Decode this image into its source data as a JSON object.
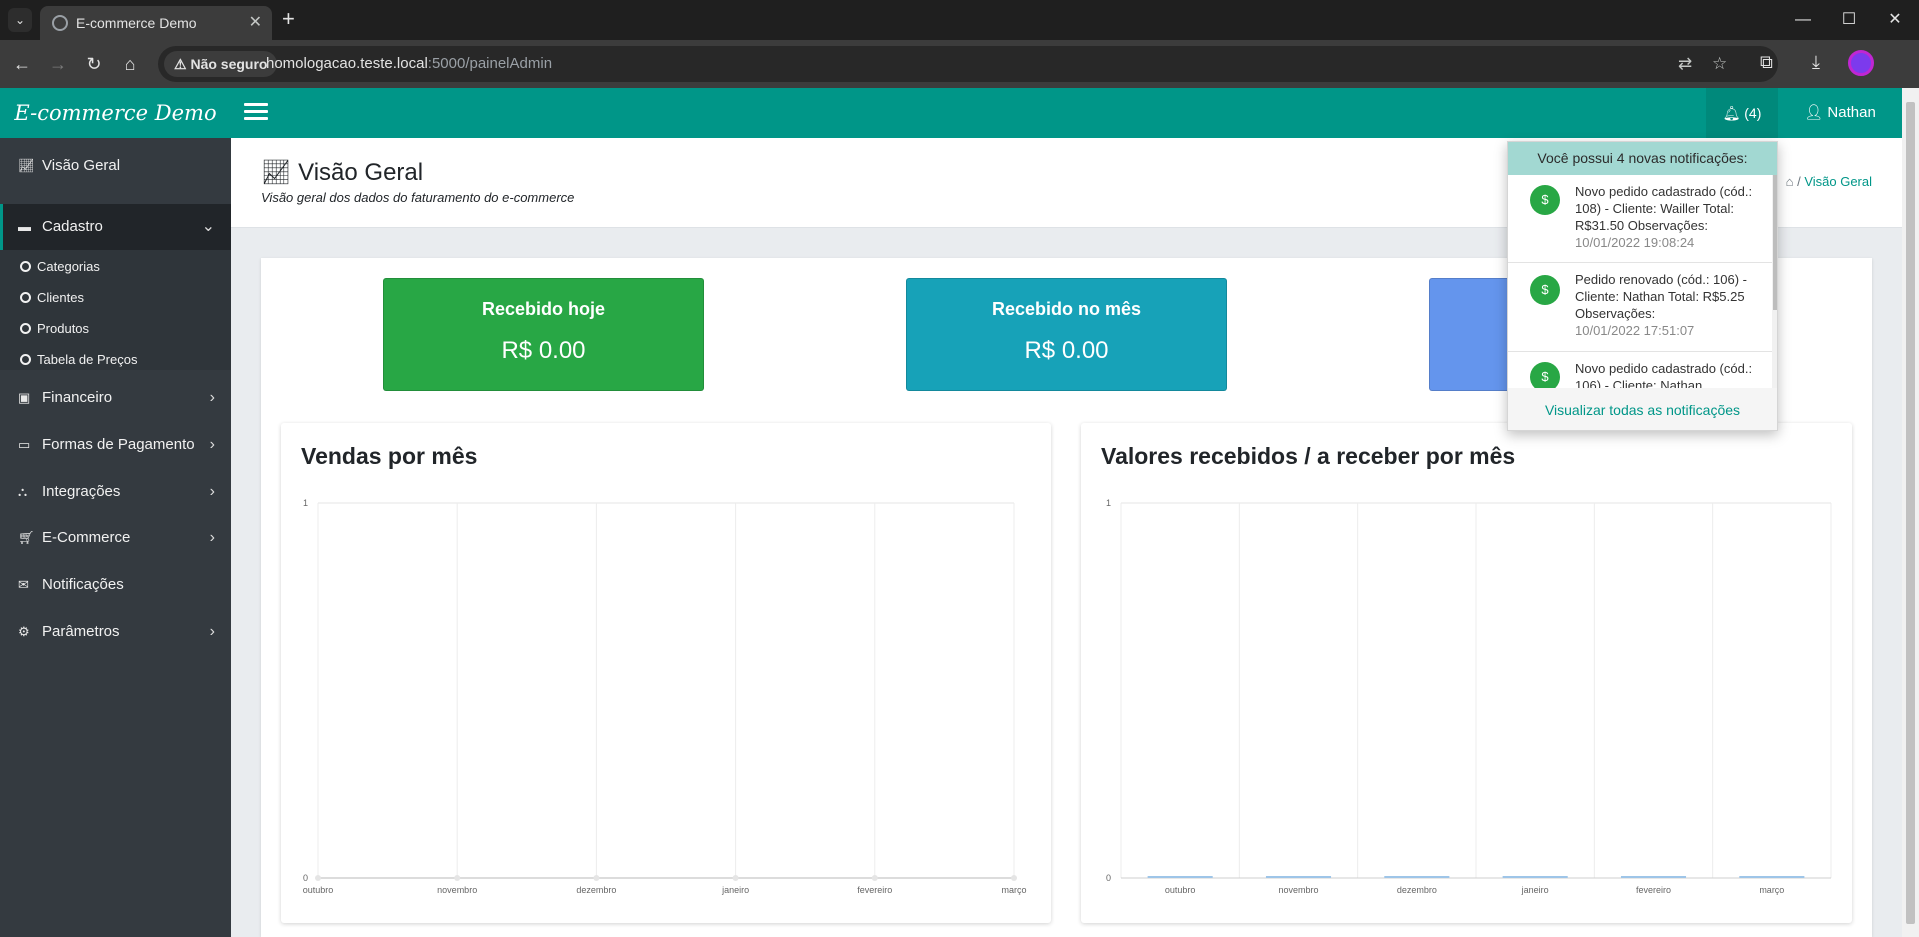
{
  "browser": {
    "tab_title": "E-commerce Demo",
    "security_label": "Não seguro",
    "url_host": "homologacao.teste.local",
    "url_path": ":5000/painelAdmin"
  },
  "header": {
    "brand": "E-commerce Demo",
    "notif_count": "(4)",
    "user_name": "Nathan"
  },
  "sidebar": {
    "items": [
      {
        "label": "Visão Geral",
        "icon": "chart-line-icon"
      },
      {
        "label": "Cadastro",
        "icon": "archive-icon"
      },
      {
        "label": "Financeiro",
        "icon": "money-icon"
      },
      {
        "label": "Formas de Pagamento",
        "icon": "credit-card-icon"
      },
      {
        "label": "Integrações",
        "icon": "sitemap-icon"
      },
      {
        "label": "E-Commerce",
        "icon": "cart-icon"
      },
      {
        "label": "Notificações",
        "icon": "envelope-icon"
      },
      {
        "label": "Parâmetros",
        "icon": "gears-icon"
      }
    ],
    "sub_items": [
      "Categorias",
      "Clientes",
      "Produtos",
      "Tabela de Preços"
    ]
  },
  "page": {
    "title": "Visão Geral",
    "subtitle": "Visão geral dos dados do faturamento do e-commerce",
    "breadcrumb_current": "Visão Geral"
  },
  "stats": [
    {
      "label": "Recebido hoje",
      "value": "R$ 0.00",
      "color": "#28a745"
    },
    {
      "label": "Recebido no mês",
      "value": "R$ 0.00",
      "color": "#17a2b8"
    },
    {
      "label": "",
      "value": "",
      "color": "#6495ed"
    }
  ],
  "notifications": {
    "header": "Você possui 4 novas notificações:",
    "items": [
      {
        "text": "Novo pedido cadastrado (cód.: 108) - Cliente: Wailler Total: R$31.50 Observações:",
        "time": "10/01/2022 19:08:24"
      },
      {
        "text": "Pedido renovado (cód.: 106) - Cliente: Nathan Total: R$5.25 Observações:",
        "time": "10/01/2022 17:51:07"
      },
      {
        "text": "Novo pedido cadastrado (cód.: 106) - Cliente: Nathan",
        "time": ""
      }
    ],
    "footer": "Visualizar todas as notificações"
  },
  "chart_data": [
    {
      "type": "line",
      "title": "Vendas por mês",
      "categories": [
        "outubro",
        "novembro",
        "dezembro",
        "janeiro",
        "fevereiro",
        "março"
      ],
      "series": [
        {
          "values": [
            0,
            0,
            0,
            0,
            0,
            0
          ]
        }
      ],
      "ylim": [
        0,
        1
      ],
      "yticks": [
        "0",
        "1"
      ],
      "grid": true
    },
    {
      "type": "bar",
      "title": "Valores recebidos / a receber por mês",
      "categories": [
        "outubro",
        "novembro",
        "dezembro",
        "janeiro",
        "fevereiro",
        "março"
      ],
      "series": [
        {
          "values": [
            0,
            0,
            0,
            0,
            0,
            0
          ]
        }
      ],
      "ylim": [
        0,
        1
      ],
      "yticks": [
        "0",
        "1"
      ],
      "grid": true
    }
  ]
}
